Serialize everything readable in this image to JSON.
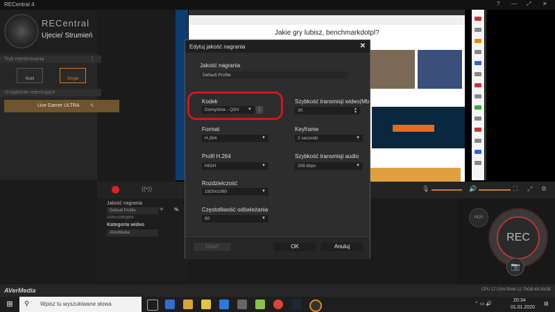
{
  "window": {
    "title": "RECentral 4",
    "controls": [
      "?",
      "—",
      "⤢",
      "✕"
    ]
  },
  "sidebar": {
    "brand": "RECentral",
    "mode_title": "Ujecie/ Strumień",
    "record_mode_header": "Tryb rejestrowania",
    "multi_label": "Multi",
    "single_label": "Single",
    "device_header": "Urządzenie rejestrujące",
    "device_name": "Live Gamer ULTRA"
  },
  "preview": {
    "heading": "Jakie gry lubisz, benchmarkdotpl?"
  },
  "bottom_panel": {
    "quality_label": "Jakość nagrania",
    "quality_value": "Default Profile",
    "quality_sub": "1920x1080@60",
    "category_label": "Kategoria wideo",
    "category_value": "AVerMedia"
  },
  "rec": {
    "rec_label": "REC",
    "hdr_label": "HDR",
    "camera_glyph": "📷"
  },
  "status": {
    "brand": "AVerMedia",
    "stats": "CPU 17.01%  RAM 12.79GB  69.00GB"
  },
  "taskbar": {
    "search_placeholder": "Wpisz tu wyszukiwane słowa",
    "time": "20:34",
    "date": "01.01.2020"
  },
  "dialog": {
    "title": "Edytuj jakość nagrania",
    "close_glyph": "✕",
    "profile_label": "Jakość nagrania",
    "profile_value": "Default Profile",
    "codec_label": "Kodek",
    "codec_value": "Domyślnie - QSV",
    "bitrate_label": "Szybkość transmisji wideo(Mb",
    "bitrate_value": "30",
    "format_label": "Format",
    "format_value": "H.264",
    "keyframe_label": "Keyframe",
    "keyframe_value": "2 seconds",
    "h264_profile_label": "Profil H.264",
    "h264_profile_value": "HIGH",
    "audio_bitrate_label": "Szybkość transmisji audio",
    "audio_bitrate_value": "256 kbps",
    "resolution_label": "Rozdzielczość",
    "resolution_value": "1920x1080",
    "refresh_label": "Częstotliwość odświeżania",
    "refresh_value": "60",
    "delete_label": "Usuń",
    "ok_label": "OK",
    "cancel_label": "Anuluj"
  }
}
